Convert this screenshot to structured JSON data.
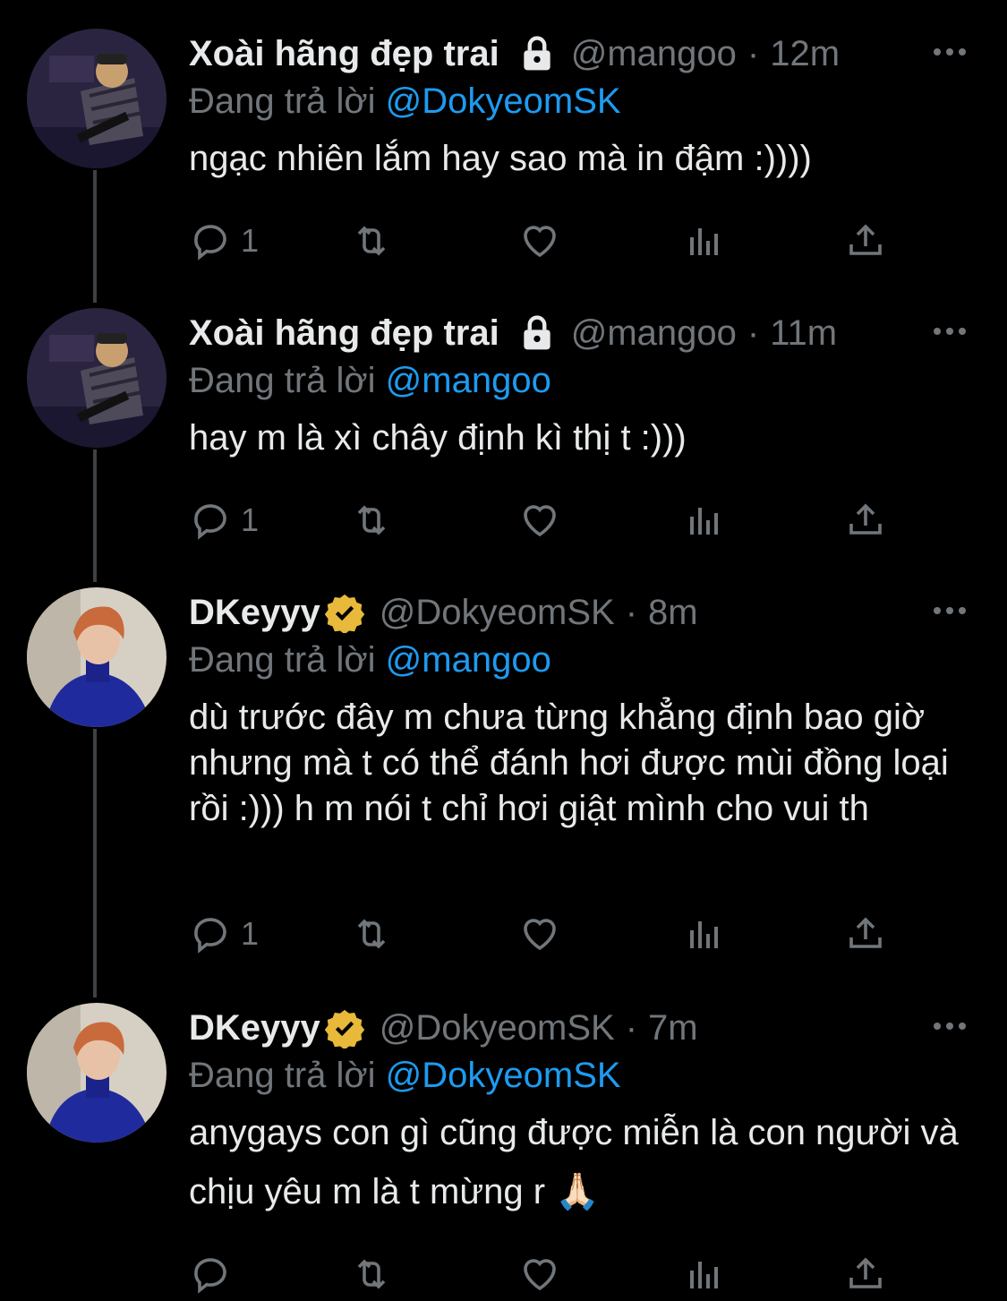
{
  "tweets": [
    {
      "name": "Xoài hãng đẹp trai",
      "handle": "@mangoo",
      "time": "12m",
      "reply_prefix": "Đang trả lời",
      "reply_to": "@DokyeomSK",
      "text": "ngạc nhiên lắm hay sao mà in đậm :))))",
      "reply_count": "1",
      "badge_icon": "lock-icon"
    },
    {
      "name": "Xoài hãng đẹp trai",
      "handle": "@mangoo",
      "time": "11m",
      "reply_prefix": "Đang trả lời",
      "reply_to": "@mangoo",
      "text": "hay m là xì chây định kì thị t :)))",
      "reply_count": "1",
      "badge_icon": "lock-icon"
    },
    {
      "name": "DKeyyy",
      "handle": "@DokyeomSK",
      "time": "8m",
      "reply_prefix": "Đang trả lời",
      "reply_to": "@mangoo",
      "text": "dù trước đây m chưa từng khẳng định bao giờ nhưng mà t có thể đánh hơi được mùi đồng loại rồi :))) h m nói t chỉ hơi giật mình cho vui th",
      "reply_count": "1",
      "badge_icon": "verified-icon"
    },
    {
      "name": "DKeyyy",
      "handle": "@DokyeomSK",
      "time": "7m",
      "reply_prefix": "Đang trả lời",
      "reply_to": "@DokyeomSK",
      "text": "anygays con gì cũng được miễn là con người và chịu yêu m là t mừng r 🙏🏻",
      "reply_count": "",
      "badge_icon": "verified-icon"
    }
  ],
  "separator": "·",
  "colors": {
    "background": "#000000",
    "text": "#e7e9ea",
    "muted": "#71767b",
    "link": "#1d9bf0",
    "verified": "#e8b93a"
  }
}
